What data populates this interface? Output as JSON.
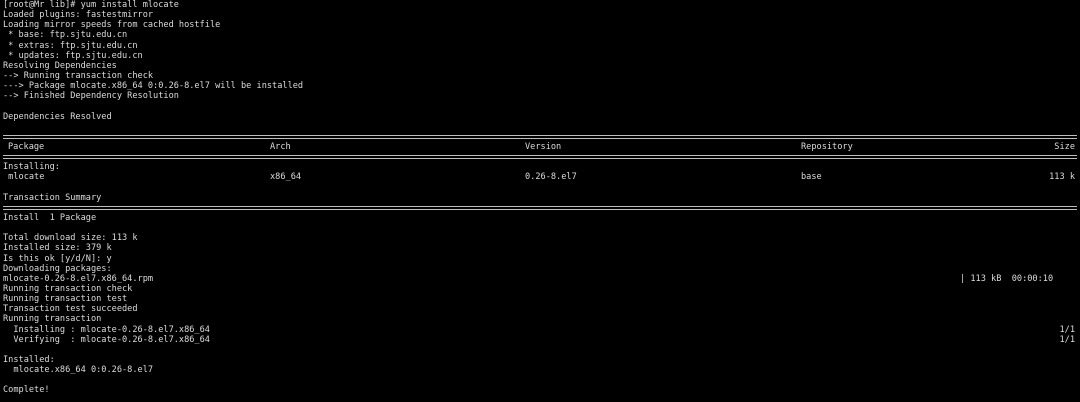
{
  "terminal": {
    "prompt_line": "[root@Mr lib]# yum install mlocate",
    "pre_lines": [
      "Loaded plugins: fastestmirror",
      "Loading mirror speeds from cached hostfile",
      " * base: ftp.sjtu.edu.cn",
      " * extras: ftp.sjtu.edu.cn",
      " * updates: ftp.sjtu.edu.cn",
      "Resolving Dependencies",
      "--> Running transaction check",
      "---> Package mlocate.x86_64 0:0.26-8.el7 will be installed",
      "--> Finished Dependency Resolution"
    ],
    "deps_resolved": "Dependencies Resolved",
    "table": {
      "headers": {
        "package": "Package",
        "arch": "Arch",
        "version": "Version",
        "repository": "Repository",
        "size": "Size"
      },
      "section_label": "Installing:",
      "rows": [
        {
          "package": " mlocate",
          "arch": "x86_64",
          "version": "0.26-8.el7",
          "repository": "base",
          "size": "113 k"
        }
      ]
    },
    "transaction_summary": "Transaction Summary",
    "install_count": "Install  1 Package",
    "post_lines": [
      "Total download size: 113 k",
      "Installed size: 379 k",
      "Is this ok [y/d/N]: y",
      "Downloading packages:"
    ],
    "download": {
      "file": "mlocate-0.26-8.el7.x86_64.rpm",
      "stats": "| 113 kB  00:00:10"
    },
    "run_lines": [
      "Running transaction check",
      "Running transaction test",
      "Transaction test succeeded",
      "Running transaction"
    ],
    "steps": [
      {
        "label": "  Installing : mlocate-0.26-8.el7.x86_64",
        "progress": "1/1"
      },
      {
        "label": "  Verifying  : mlocate-0.26-8.el7.x86_64",
        "progress": "1/1"
      }
    ],
    "installed_label": "Installed:",
    "installed_pkg": "  mlocate.x86_64 0:0.26-8.el7",
    "complete": "Complete!"
  }
}
